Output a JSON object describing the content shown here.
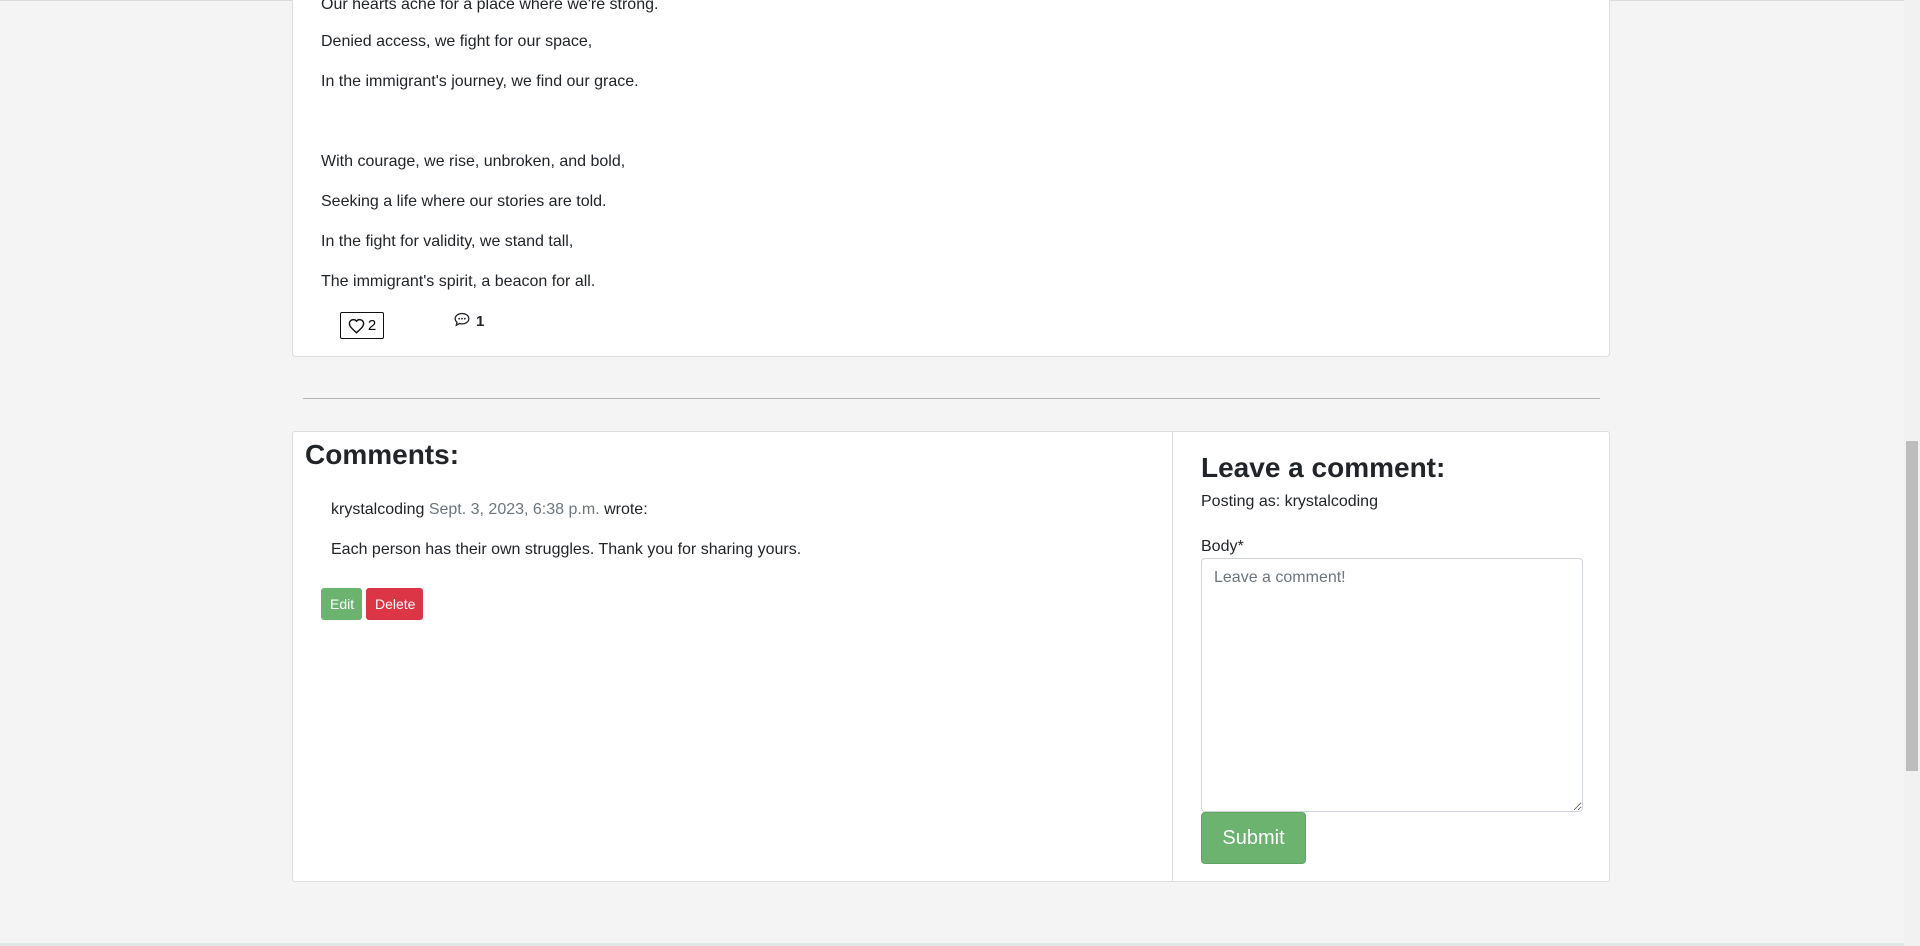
{
  "post": {
    "poem_lines": [
      "Our hearts ache for a place where we're strong.",
      "Denied access, we fight for our space,",
      "In the immigrant's journey, we find our grace.",
      "With courage, we rise, unbroken, and bold,",
      "Seeking a life where our stories are told.",
      "In the fight for validity, we stand tall,",
      "The immigrant's spirit, a beacon for all."
    ],
    "likes_count": "2",
    "comments_count": "1",
    "like_icon": "heart-outline-icon",
    "comment_icon": "speech-bubble-icon"
  },
  "comments": {
    "title": "Comments:",
    "items": [
      {
        "author": "krystalcoding",
        "date": "Sept. 3, 2023, 6:38 p.m.",
        "wrote": "wrote:",
        "body": "Each person has their own struggles. Thank you for sharing yours.",
        "edit_label": "Edit",
        "delete_label": "Delete"
      }
    ]
  },
  "leave_comment": {
    "title": "Leave a comment:",
    "posting_as": "Posting as: krystalcoding",
    "body_label": "Body*",
    "body_placeholder": "Leave a comment!",
    "submit_label": "Submit"
  },
  "colors": {
    "edit_button": "#6bb36f",
    "delete_button": "#dc3545",
    "submit_button": "#6bb36f",
    "date_text": "#6c757d"
  }
}
